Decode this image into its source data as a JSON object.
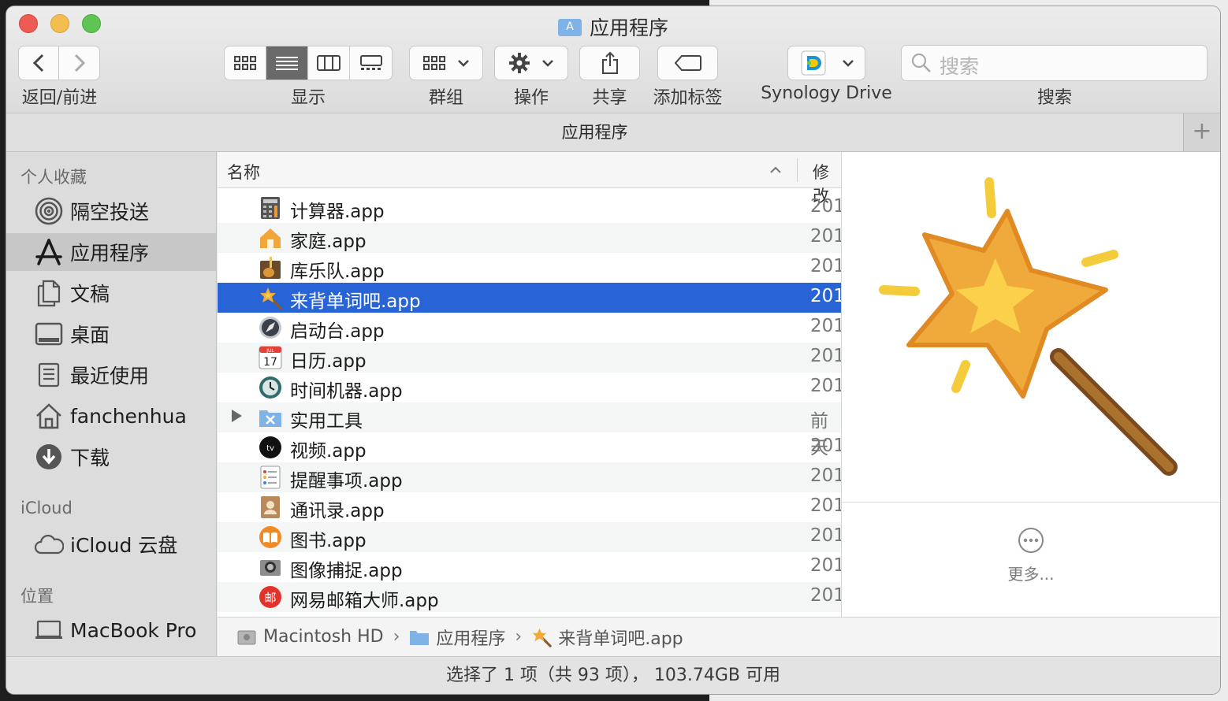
{
  "window": {
    "title": "应用程序",
    "title_icon_glyph": "A",
    "path_title": "应用程序"
  },
  "colors": {
    "selection": "#2864d5",
    "close": "#ee5b54",
    "minimize": "#f4bd4f",
    "zoom": "#5fc453"
  },
  "toolbar": {
    "nav_label": "返回/前进",
    "view_label": "显示",
    "group_label": "群组",
    "action_label": "操作",
    "share_label": "共享",
    "tags_label": "添加标签",
    "synology_label": "Synology Drive",
    "search_label": "搜索",
    "search_placeholder": "搜索"
  },
  "sidebar": {
    "favorites_header": "个人收藏",
    "favorites": [
      {
        "label": "隔空投送",
        "icon": "airdrop-icon"
      },
      {
        "label": "应用程序",
        "icon": "applications-icon",
        "selected": true
      },
      {
        "label": "文稿",
        "icon": "documents-icon"
      },
      {
        "label": "桌面",
        "icon": "desktop-icon"
      },
      {
        "label": "最近使用",
        "icon": "recents-icon"
      },
      {
        "label": "fanchenhua",
        "icon": "home-icon"
      },
      {
        "label": "下载",
        "icon": "downloads-icon"
      }
    ],
    "icloud_header": "iCloud",
    "icloud": [
      {
        "label": "iCloud 云盘",
        "icon": "cloud-icon"
      }
    ],
    "locations_header": "位置",
    "locations": [
      {
        "label": "MacBook Pro",
        "icon": "laptop-icon"
      }
    ]
  },
  "list": {
    "col_name": "名称",
    "col_modified": "修改",
    "rows": [
      {
        "name": "计算器.app",
        "date": "201",
        "icon": "calculator-icon"
      },
      {
        "name": "家庭.app",
        "date": "201",
        "icon": "home-app-icon"
      },
      {
        "name": "库乐队.app",
        "date": "201",
        "icon": "garageband-icon"
      },
      {
        "name": "来背单词吧.app",
        "date": "201",
        "icon": "magic-wand-icon",
        "selected": true
      },
      {
        "name": "启动台.app",
        "date": "201",
        "icon": "launchpad-icon"
      },
      {
        "name": "日历.app",
        "date": "201",
        "icon": "calendar-icon"
      },
      {
        "name": "时间机器.app",
        "date": "201",
        "icon": "time-machine-icon"
      },
      {
        "name": "实用工具",
        "date": "前天",
        "icon": "utilities-folder-icon",
        "folder": true
      },
      {
        "name": "视频.app",
        "date": "201",
        "icon": "tv-icon"
      },
      {
        "name": "提醒事项.app",
        "date": "201",
        "icon": "reminders-icon"
      },
      {
        "name": "通讯录.app",
        "date": "201",
        "icon": "contacts-icon"
      },
      {
        "name": "图书.app",
        "date": "201",
        "icon": "books-icon"
      },
      {
        "name": "图像捕捉.app",
        "date": "201",
        "icon": "image-capture-icon"
      },
      {
        "name": "网易邮箱大师.app",
        "date": "201",
        "icon": "netease-mail-icon"
      }
    ],
    "calendar_day": "17",
    "calendar_month": "JUL",
    "tv_text": "tv",
    "netease_glyph": "邮"
  },
  "preview": {
    "more_label": "更多..."
  },
  "breadcrumbs": [
    {
      "label": "Macintosh HD",
      "icon": "hard-drive-icon"
    },
    {
      "label": "应用程序",
      "icon": "applications-folder-icon"
    },
    {
      "label": "来背单词吧.app",
      "icon": "magic-wand-icon"
    }
  ],
  "status": {
    "text": "选择了 1 项（共 93 项）， 103.74GB 可用"
  }
}
